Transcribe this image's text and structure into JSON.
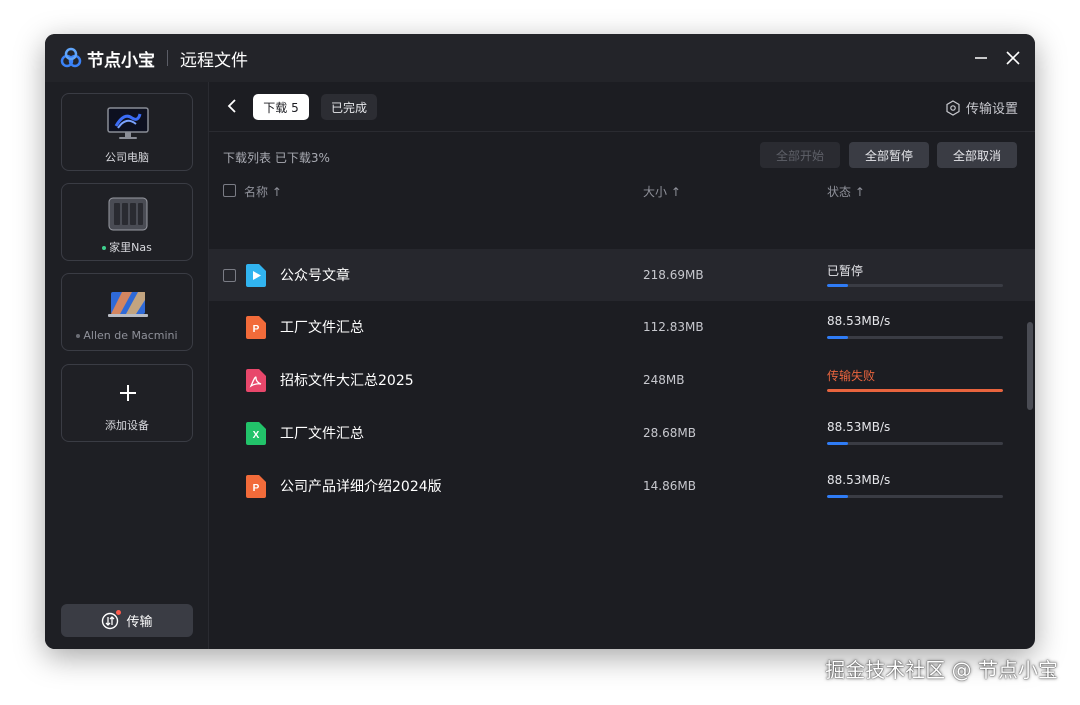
{
  "app": {
    "name": "节点小宝",
    "title": "远程文件"
  },
  "sidebar": {
    "devices": [
      {
        "label": "公司电脑",
        "icon": "desktop-computer-icon"
      },
      {
        "label": "家里Nas",
        "icon": "nas-icon",
        "online": true
      },
      {
        "label": "Allen de Macmini",
        "icon": "laptop-icon",
        "online": false
      }
    ],
    "add_device_label": "添加设备",
    "transfer_label": "传输"
  },
  "topbar": {
    "tab_downloading": "下载 5",
    "tab_completed": "已完成",
    "settings_label": "传输设置"
  },
  "list": {
    "info": "下载列表 已下载3%",
    "buttons": {
      "start_all": "全部开始",
      "pause_all": "全部暂停",
      "cancel_all": "全部取消"
    },
    "columns": {
      "name": "名称 ↑",
      "size": "大小 ↑",
      "status": "状态 ↑"
    },
    "rows": [
      {
        "name": "公众号文章",
        "type": "video",
        "size": "218.69MB",
        "status": "已暂停",
        "progress": 0.12,
        "failed": false
      },
      {
        "name": "工厂文件汇总",
        "type": "ppt",
        "size": "112.83MB",
        "status": "88.53MB/s",
        "progress": 0.12,
        "failed": false
      },
      {
        "name": "招标文件大汇总2025",
        "type": "pdf",
        "size": "248MB",
        "status": "传输失败",
        "progress": 1.0,
        "failed": true
      },
      {
        "name": "工厂文件汇总",
        "type": "excel",
        "size": "28.68MB",
        "status": "88.53MB/s",
        "progress": 0.12,
        "failed": false
      },
      {
        "name": "公司产品详细介绍2024版",
        "type": "ppt",
        "size": "14.86MB",
        "status": "88.53MB/s",
        "progress": 0.12,
        "failed": false
      }
    ]
  },
  "colors": {
    "accent": "#2f7cf6",
    "fail": "#e8643e",
    "online": "#3ecf8e"
  },
  "watermark": "掘金技术社区 @ 节点小宝"
}
